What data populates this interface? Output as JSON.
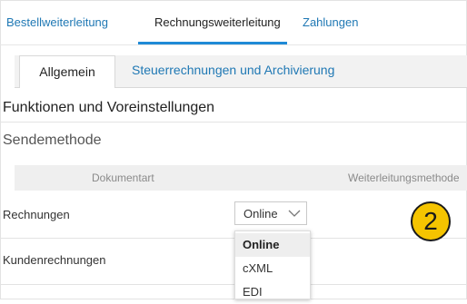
{
  "top_tabs": [
    {
      "label": "Bestellweiterleitung"
    },
    {
      "label": "Rechnungsweiterleitung"
    },
    {
      "label": "Zahlungen"
    }
  ],
  "sub_tabs": [
    {
      "label": "Allgemein"
    },
    {
      "label": "Steuerrechnungen und Archivierung"
    }
  ],
  "section_title": "Funktionen und Voreinstellungen",
  "subsection_title": "Sendemethode",
  "table": {
    "columns": [
      "Dokumentart",
      "Weiterleitungsmethode"
    ],
    "rows": [
      {
        "label": "Rechnungen"
      },
      {
        "label": "Kundenrechnungen"
      }
    ]
  },
  "select": {
    "value": "Online",
    "options": [
      "Online",
      "cXML",
      "EDI"
    ]
  },
  "step_badge": "2",
  "colors": {
    "link": "#1f78b4",
    "accent": "#1f8ad6",
    "badge": "#f5c400"
  },
  "icons": {
    "select_chevron": "chevron-down-icon"
  }
}
